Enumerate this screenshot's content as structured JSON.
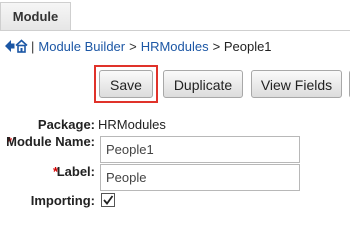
{
  "tab": {
    "label": "Module"
  },
  "breadcrumb": {
    "back_icon": "back-arrow-icon",
    "home_icon": "home-icon",
    "separator": "|",
    "items": [
      {
        "label": "Module Builder",
        "link": true
      },
      {
        "label": ">",
        "link": false
      },
      {
        "label": "HRModules",
        "link": true
      },
      {
        "label": "> People1",
        "link": false
      }
    ]
  },
  "toolbar": {
    "save_label": "Save",
    "duplicate_label": "Duplicate",
    "view_fields_label": "View Fields"
  },
  "form": {
    "package_label": "Package:",
    "package_value": "HRModules",
    "module_name_label": "Module Name:",
    "module_name_value": "People1",
    "label_label": "Label:",
    "label_value": "People",
    "importing_label": "Importing:",
    "importing_checked": true,
    "required_marker": "*"
  },
  "colors": {
    "link": "#1c57a5",
    "required": "#d30000",
    "highlight": "#e0322a"
  }
}
